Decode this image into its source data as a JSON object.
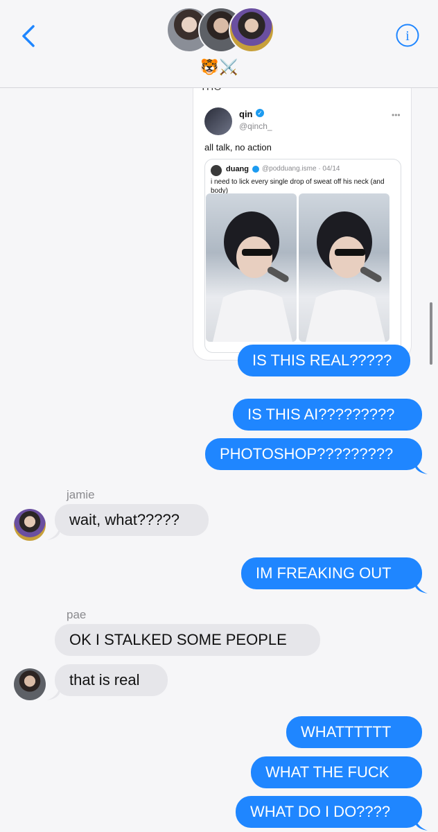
{
  "header": {
    "back_label": "Back",
    "group_name": "🐯⚔️",
    "info_label": "i",
    "avatars": [
      "avatar-1",
      "avatar-2",
      "avatar-3"
    ]
  },
  "shared_post": {
    "top_cut_text": "THO",
    "author_name": "qin",
    "author_handle": "@qinch_",
    "more": "•••",
    "text": "all talk, no action",
    "quote": {
      "name": "duang",
      "handle": "@podduang.isme · 04/14",
      "text": "i need to lick every single drop of sweat off his neck (and body)"
    }
  },
  "messages": [
    {
      "side": "out",
      "text": "IS THIS REAL?????"
    },
    {
      "side": "out",
      "text": "IS THIS AI?????????"
    },
    {
      "side": "out",
      "text": "PHOTOSHOP?????????"
    },
    {
      "side": "in",
      "sender": "jamie",
      "text": "wait, what?????"
    },
    {
      "side": "out",
      "text": "IM FREAKING OUT"
    },
    {
      "side": "in",
      "sender": "pae",
      "text": "OK I STALKED SOME PEOPLE"
    },
    {
      "side": "in",
      "text": "that is real"
    },
    {
      "side": "out",
      "text": "WHATTTTTT"
    },
    {
      "side": "out",
      "text": "WHAT THE FUCK"
    },
    {
      "side": "out",
      "text": "WHAT DO I DO????"
    }
  ],
  "colors": {
    "outgoing": "#1f86ff",
    "incoming": "#e6e6ea",
    "accent": "#1f86ff"
  }
}
